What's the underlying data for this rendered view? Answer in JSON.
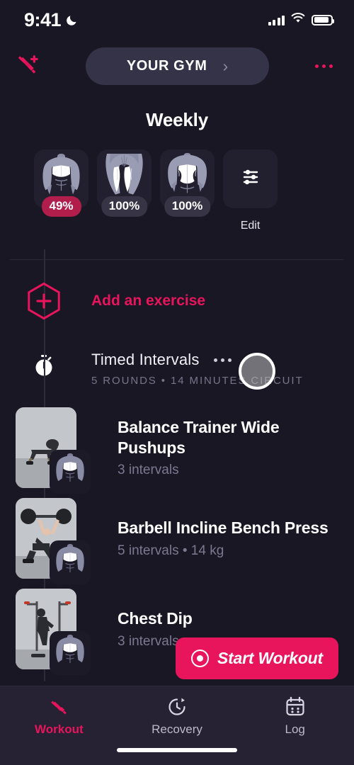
{
  "status_bar": {
    "time": "9:41",
    "moon_icon": "crescent-moon-icon",
    "signal_icon": "cellular-signal-icon",
    "wifi_icon": "wifi-icon",
    "battery_icon": "battery-icon"
  },
  "header": {
    "add_workout_icon": "dumbbell-plus-icon",
    "gym_label": "YOUR GYM",
    "gym_chevron": "chevron-right-icon",
    "overflow_icon": "more-horizontal-icon"
  },
  "weekly": {
    "title": "Weekly",
    "cards": [
      {
        "name": "chest-muscle-card",
        "art": "chest",
        "percent": "49%",
        "highlight": true
      },
      {
        "name": "legs-muscle-card",
        "art": "legs",
        "percent": "100%",
        "highlight": false
      },
      {
        "name": "back-muscle-card",
        "art": "back",
        "percent": "100%",
        "highlight": false
      }
    ],
    "edit_icon": "sliders-icon",
    "edit_label": "Edit"
  },
  "add_exercise": {
    "icon": "hexagon-plus-icon",
    "label": "Add an exercise"
  },
  "block": {
    "icon": "stopwatch-icon",
    "title": "Timed Intervals",
    "overflow_icon": "more-horizontal-icon",
    "subtitle": "5 ROUNDS • 14 MINUTES CIRCUIT"
  },
  "exercises": [
    {
      "thumb": "pushup",
      "badge": "chest",
      "name": "Balance Trainer Wide Pushups",
      "detail": "3 intervals"
    },
    {
      "thumb": "bench",
      "badge": "chest",
      "name": "Barbell Incline Bench Press",
      "detail": "5 intervals • 14 kg"
    },
    {
      "thumb": "dip",
      "badge": "chest",
      "name": "Chest Dip",
      "detail": "3 intervals"
    }
  ],
  "start_button": {
    "icon": "record-circle-icon",
    "label": "Start Workout"
  },
  "tabs": [
    {
      "icon": "dumbbell-icon",
      "label": "Workout",
      "active": true
    },
    {
      "icon": "recovery-clock-icon",
      "label": "Recovery",
      "active": false
    },
    {
      "icon": "calendar-icon",
      "label": "Log",
      "active": false
    }
  ],
  "colors": {
    "accent": "#e8145c",
    "accent_dark": "#b11e4b",
    "background": "#1a1725",
    "surface": "#22202e",
    "pill": "#353347",
    "tabbar": "#262233",
    "muted_text": "#7b7890"
  }
}
